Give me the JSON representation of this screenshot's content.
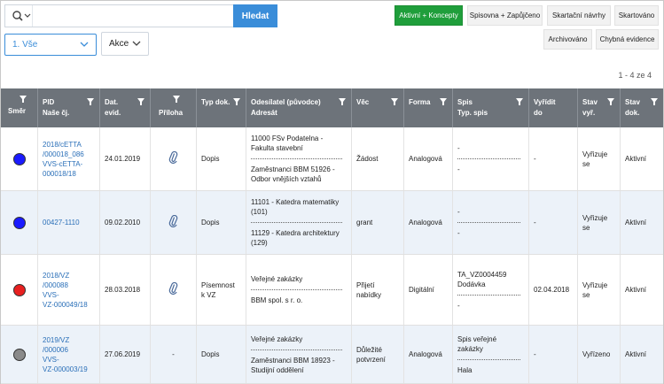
{
  "search": {
    "placeholder": "",
    "button_label": "Hledat"
  },
  "filter": {
    "selected": "1. Vše"
  },
  "actions": {
    "label": "Akce"
  },
  "toggles": [
    {
      "label": "Aktivní + Koncepty",
      "active": true
    },
    {
      "label": "Spisovna + Zapůjčeno",
      "active": false
    },
    {
      "label": "Skartační návrhy",
      "active": false
    },
    {
      "label": "Skartováno",
      "active": false
    },
    {
      "label": "Archivováno",
      "active": false
    },
    {
      "label": "Chybná evidence",
      "active": false
    }
  ],
  "pager": {
    "text": "1 - 4 ze 4"
  },
  "columns": [
    {
      "label": "Směr"
    },
    {
      "label": "PID\nNaše čj."
    },
    {
      "label": "Dat.\nevid."
    },
    {
      "label": "Příloha"
    },
    {
      "label": "Typ dok."
    },
    {
      "label": "Odesílatel (původce)\nAdresát"
    },
    {
      "label": "Věc"
    },
    {
      "label": "Forma"
    },
    {
      "label": "Spis\nTyp. spis"
    },
    {
      "label": "Vyřídit\ndo"
    },
    {
      "label": "Stav\nvyř."
    },
    {
      "label": "Stav\ndok."
    }
  ],
  "rows": [
    {
      "dot_color": "#1a1aff",
      "pid": "2018/cETTA\n/000018_086\nVVS-cETTA-\n000018/18",
      "date": "24.01.2019",
      "attachment": "paperclip",
      "doc_type": "Dopis",
      "sender": "11000 FSv Podatelna - Fakulta stavební",
      "addressee": "Zaměstnanci BBM 51926 - Odbor vnějších vztahů",
      "subject": "Žádost",
      "form": "Analogová",
      "file": "-",
      "file_type": "-",
      "due": "-",
      "state_proc": "Vyřizuje\nse",
      "state_doc": "Aktivní"
    },
    {
      "dot_color": "#1a1aff",
      "pid": "00427-1110",
      "date": "09.02.2010",
      "attachment": "paperclip",
      "doc_type": "Dopis",
      "sender": "11101 - Katedra matematiky (101)",
      "addressee": "11129 - Katedra architektury (129)",
      "subject": "grant",
      "form": "Analogová",
      "file": "-",
      "file_type": "-",
      "due": "-",
      "state_proc": "Vyřizuje\nse",
      "state_doc": "Aktivní"
    },
    {
      "dot_color": "#e82020",
      "pid": "2018/VZ\n/000088\nVVS-\nVZ-000049/18",
      "date": "28.03.2018",
      "attachment": "paperclip",
      "doc_type": "Písemnost\nk VZ",
      "sender": "Veřejné zakázky",
      "addressee": "BBM spol. s r. o.",
      "subject": "Přijetí\nnabídky",
      "form": "Digitální",
      "file": "TA_VZ0004459\nDodávka",
      "file_type": "-",
      "due": "02.04.2018",
      "state_proc": "Vyřizuje\nse",
      "state_doc": "Aktivní"
    },
    {
      "dot_color": "#8a8a8a",
      "pid": "2019/VZ\n/000006\nVVS-\nVZ-000003/19",
      "date": "27.06.2019",
      "attachment": "-",
      "doc_type": "Dopis",
      "sender": "Veřejné zakázky",
      "addressee": "Zaměstnanci BBM 18923 - Studijní oddělení",
      "subject": "Důležité\npotvrzení",
      "form": "Analogová",
      "file": "Spis veřejné zakázky",
      "file_type": "Hala",
      "due": "-",
      "state_proc": "Vyřízeno",
      "state_doc": "Aktivní"
    }
  ]
}
